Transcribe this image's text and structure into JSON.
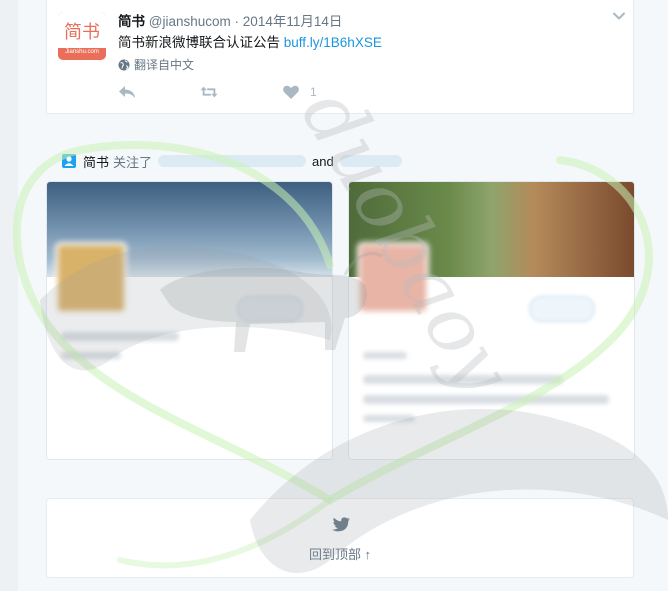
{
  "tweet": {
    "avatar_text": "简书",
    "avatar_domain": "Jianshu.com",
    "author_name": "简书",
    "handle": "@jianshucom",
    "separator": "·",
    "timestamp": "2014年11月14日",
    "text": "简书新浪微博联合认证公告",
    "link": "buff.ly/1B6hXSE",
    "translate_label": "翻译自中文",
    "like_count": "1",
    "icons": [
      "chevron-down-icon",
      "globe-icon",
      "reply-icon",
      "retweet-icon",
      "heart-icon"
    ]
  },
  "follow_notice": {
    "who": "简书",
    "action": "关注了",
    "conjunction": "and"
  },
  "back_to_top": {
    "label": "回到顶部 ↑",
    "icon": "twitter-bird-icon"
  },
  "watermark": {
    "text": "duobaoy"
  },
  "colors": {
    "accent": "#1da1f2",
    "link": "#1b95e0",
    "brand": "#ea6f5a",
    "muted": "#657786",
    "background": "#f5f8fa"
  }
}
